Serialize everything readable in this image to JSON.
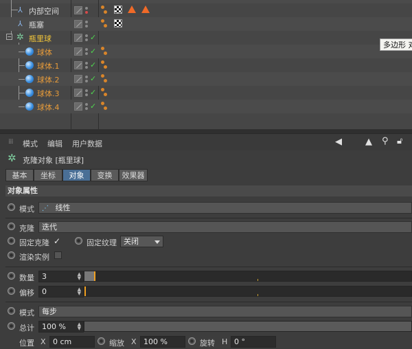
{
  "object_manager": {
    "objects": [
      {
        "name": "内部空间",
        "color": "white",
        "tags": [
          "checker",
          "triangle",
          "triangle"
        ]
      },
      {
        "name": "瓶塞",
        "color": "white",
        "tags": [
          "checker"
        ]
      },
      {
        "name": "瓶里球",
        "color": "yellow",
        "tags": []
      },
      {
        "name": "球体",
        "color": "orange",
        "tags": []
      },
      {
        "name": "球体.1",
        "color": "orange",
        "tags": []
      },
      {
        "name": "球体.2",
        "color": "orange",
        "tags": []
      },
      {
        "name": "球体.3",
        "color": "orange",
        "tags": []
      },
      {
        "name": "球体.4",
        "color": "orange",
        "tags": []
      }
    ],
    "tooltip": "多边形 对"
  },
  "attribute_manager": {
    "menu": {
      "mode": "模式",
      "edit": "编辑",
      "userdata": "用户数据"
    },
    "title": "克隆对象 [瓶里球]",
    "tabs": [
      "基本",
      "坐标",
      "对象",
      "变换",
      "效果器"
    ],
    "active_tab": "对象",
    "section_title": "对象属性",
    "rows": {
      "mode_label": "模式",
      "mode_value": "线性",
      "clone_label": "克隆",
      "clone_value": "迭代",
      "fixed_clone_label": "固定克隆",
      "fixed_clone_check": "✓",
      "fixed_texture_label": "固定纹理",
      "fixed_texture_value": "关闭",
      "render_instance_label": "渲染实例",
      "count_label": "数量",
      "count_value": "3",
      "offset_label": "偏移",
      "offset_value": "0",
      "mode2_label": "模式",
      "mode2_value": "每步",
      "total_label": "总计",
      "total_value": "100 %",
      "position_label": "位置",
      "position_axis": "X",
      "position_value": "0 cm",
      "scale_label": "缩放",
      "scale_axis": "X",
      "scale_value": "100 %",
      "rotation_label": "旋转",
      "rotation_axis": "H",
      "rotation_value": "0 °"
    }
  }
}
